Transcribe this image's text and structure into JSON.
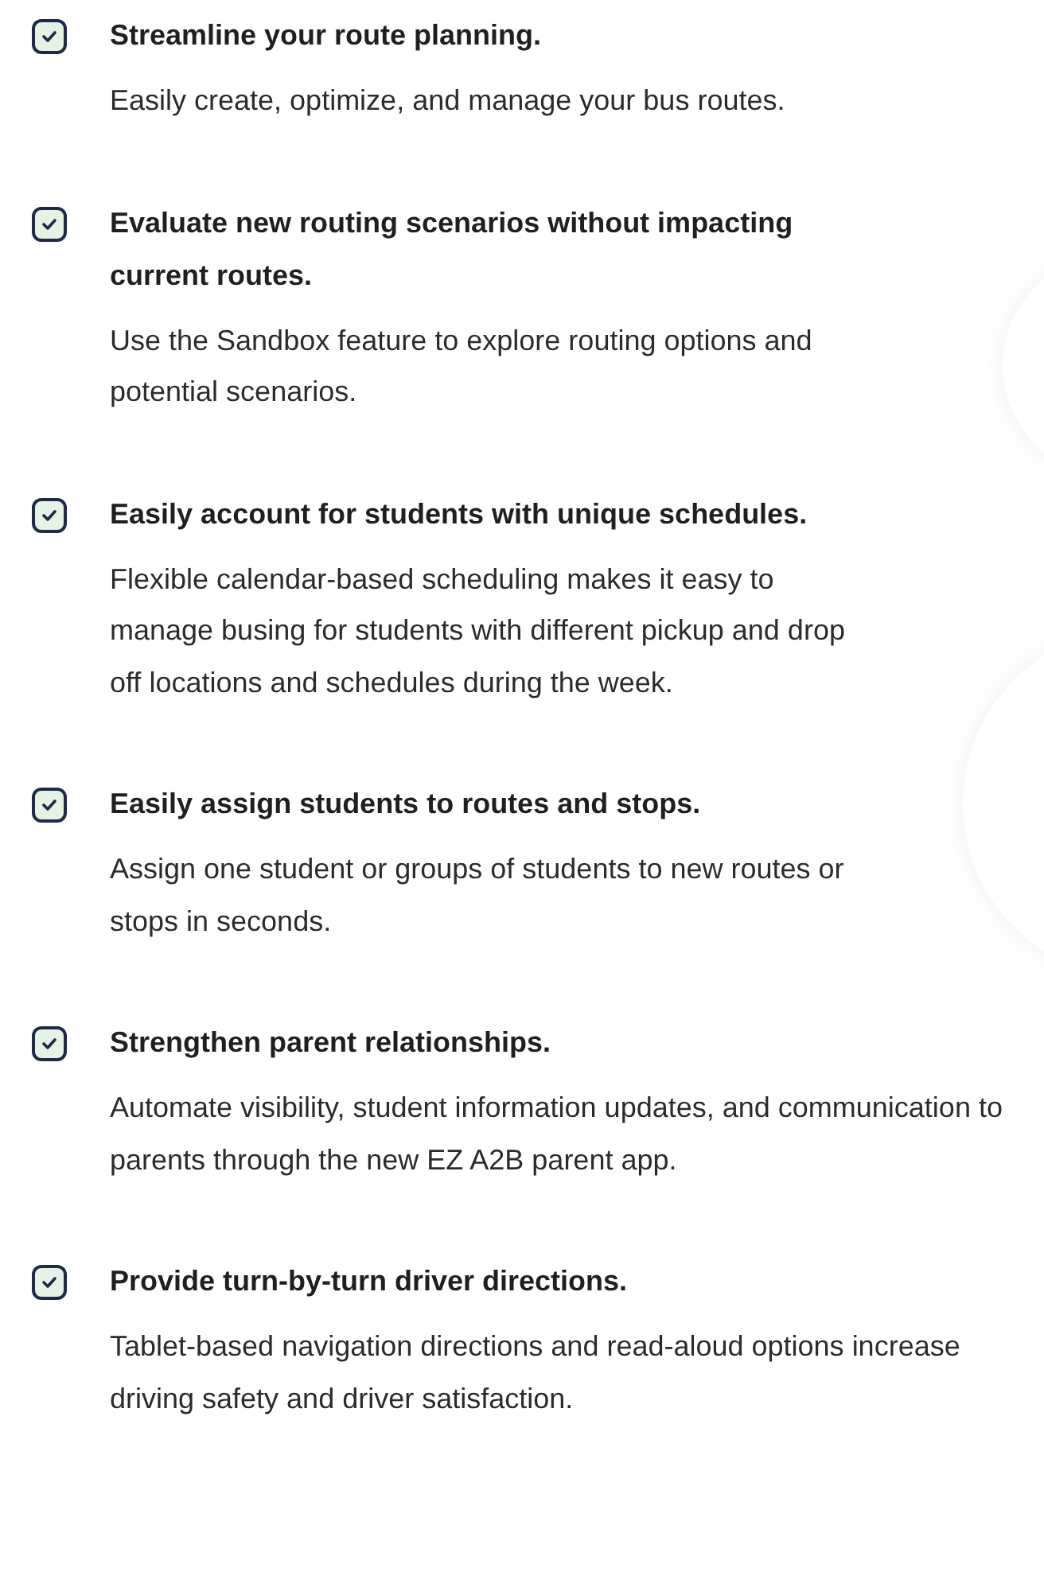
{
  "features": [
    {
      "title": "Streamline your route planning.",
      "description": "Easily create, optimize, and manage your bus routes.",
      "checked": true
    },
    {
      "title": "Evaluate new routing scenarios without impacting current routes.",
      "description": "Use the Sandbox feature to explore routing options and potential scenarios.",
      "checked": true
    },
    {
      "title": "Easily account for students with unique schedules.",
      "description": "Flexible calendar-based scheduling makes it easy to manage busing for students with different pickup and drop off locations and schedules during the week.",
      "checked": true
    },
    {
      "title": "Easily assign students to routes and stops.",
      "description": "Assign one student or groups of students to new routes or stops in seconds.",
      "checked": true
    },
    {
      "title": "Strengthen parent relationships.",
      "description": "Automate visibility, student information updates, and communication to parents through the new EZ A2B parent app.",
      "checked": true
    },
    {
      "title": "Provide turn-by-turn driver directions.",
      "description": "Tablet-based navigation directions and read-aloud options increase driving safety and driver satisfaction.",
      "checked": true
    }
  ]
}
